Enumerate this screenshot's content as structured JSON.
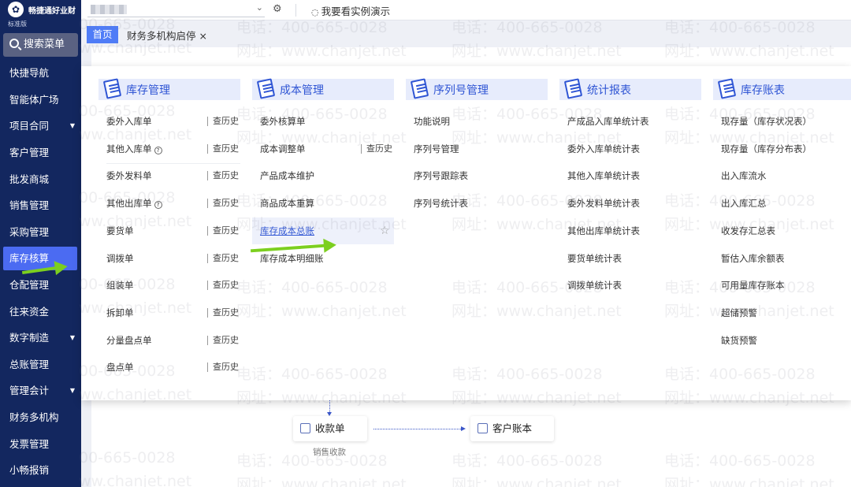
{
  "app": {
    "name": "畅捷通好业财",
    "edition": "标准版",
    "logo_glyph": "✿"
  },
  "sidebar": {
    "search_label": "搜索菜单",
    "items": [
      {
        "label": "快捷导航",
        "caret": ""
      },
      {
        "label": "智能体广场",
        "caret": ""
      },
      {
        "label": "项目合同",
        "caret": "▼"
      },
      {
        "label": "客户管理",
        "caret": ""
      },
      {
        "label": "批发商城",
        "caret": ""
      },
      {
        "label": "销售管理",
        "caret": ""
      },
      {
        "label": "采购管理",
        "caret": ""
      },
      {
        "label": "库存核算",
        "caret": ""
      },
      {
        "label": "仓配管理",
        "caret": ""
      },
      {
        "label": "往来资金",
        "caret": ""
      },
      {
        "label": "数字制造",
        "caret": "▼"
      },
      {
        "label": "总账管理",
        "caret": ""
      },
      {
        "label": "管理会计",
        "caret": "▼"
      },
      {
        "label": "财务多机构",
        "caret": ""
      },
      {
        "label": "发票管理",
        "caret": ""
      },
      {
        "label": "小畅报销",
        "caret": ""
      }
    ],
    "active_index": 7
  },
  "topbar": {
    "org_caret": "⌄",
    "gear_icon": "⚙",
    "demo_icon": "◌",
    "demo_label": "我要看实例演示"
  },
  "tabs": {
    "home": "首页",
    "current": "财务多机构启停 ×"
  },
  "menu": {
    "history_label": "查历史",
    "columns": [
      {
        "title": "库存管理",
        "items": [
          {
            "label": "委外入库单",
            "history": true,
            "help": false
          },
          {
            "label": "其他入库单",
            "history": true,
            "help": true
          },
          {
            "label": "委外发料单",
            "history": true,
            "help": false
          },
          {
            "label": "其他出库单",
            "history": true,
            "help": true
          },
          {
            "label": "要货单",
            "history": true,
            "help": false
          },
          {
            "label": "调拨单",
            "history": true,
            "help": false
          },
          {
            "label": "组装单",
            "history": true,
            "help": false
          },
          {
            "label": "拆卸单",
            "history": true,
            "help": false
          },
          {
            "label": "分量盘点单",
            "history": true,
            "help": false
          },
          {
            "label": "盘点单",
            "history": true,
            "help": false
          }
        ]
      },
      {
        "title": "成本管理",
        "items": [
          {
            "label": "委外核算单",
            "history": false,
            "help": false
          },
          {
            "label": "成本调整单",
            "history": true,
            "help": false
          },
          {
            "label": "产品成本维护",
            "history": false,
            "help": false
          },
          {
            "label": "商品成本重算",
            "history": false,
            "help": false
          },
          {
            "label": "库存成本总账",
            "history": false,
            "help": false,
            "hovered": true
          },
          {
            "label": "库存成本明细账",
            "history": false,
            "help": false
          }
        ]
      },
      {
        "title": "序列号管理",
        "items": [
          {
            "label": "功能说明",
            "history": false,
            "help": false
          },
          {
            "label": "序列号管理",
            "history": false,
            "help": false
          },
          {
            "label": "序列号跟踪表",
            "history": false,
            "help": false
          },
          {
            "label": "序列号统计表",
            "history": false,
            "help": false
          }
        ]
      },
      {
        "title": "统计报表",
        "items": [
          {
            "label": "产成品入库单统计表",
            "history": false,
            "help": false
          },
          {
            "label": "委外入库单统计表",
            "history": false,
            "help": false
          },
          {
            "label": "其他入库单统计表",
            "history": false,
            "help": false
          },
          {
            "label": "委外发料单统计表",
            "history": false,
            "help": false
          },
          {
            "label": "其他出库单统计表",
            "history": false,
            "help": false
          },
          {
            "label": "要货单统计表",
            "history": false,
            "help": false
          },
          {
            "label": "调拨单统计表",
            "history": false,
            "help": false
          }
        ]
      },
      {
        "title": "库存账表",
        "items": [
          {
            "label": "现存量（库存状况表）",
            "history": false,
            "help": false
          },
          {
            "label": "现存量（库存分布表）",
            "history": false,
            "help": false
          },
          {
            "label": "出入库流水",
            "history": false,
            "help": false
          },
          {
            "label": "出入库汇总",
            "history": false,
            "help": false
          },
          {
            "label": "收发存汇总表",
            "history": false,
            "help": false
          },
          {
            "label": "暂估入库余额表",
            "history": false,
            "help": false
          },
          {
            "label": "可用量库存账本",
            "history": false,
            "help": false
          },
          {
            "label": "超储预警",
            "history": false,
            "help": false
          },
          {
            "label": "缺货预警",
            "history": false,
            "help": false
          }
        ]
      }
    ],
    "help_glyph": "?",
    "star_glyph": "☆"
  },
  "workspace": {
    "card_receipt": "收款单",
    "card_customer": "客户账本",
    "caption": "销售收款"
  },
  "watermark": {
    "phone": "电话：400-665-0028",
    "site": "网址：www.chanjet.net",
    "phone_short": "00-665-0028",
    "site_short": "ww.chanjet.net"
  }
}
